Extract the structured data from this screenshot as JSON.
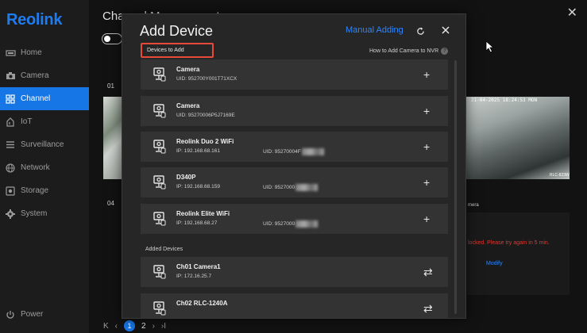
{
  "sidebar": {
    "logo": "Reolink",
    "items": [
      {
        "label": "Home",
        "icon": "home-icon"
      },
      {
        "label": "Camera",
        "icon": "camera-icon"
      },
      {
        "label": "Channel",
        "icon": "channel-grid-icon",
        "active": true
      },
      {
        "label": "IoT",
        "icon": "iot-icon"
      },
      {
        "label": "Surveillance",
        "icon": "surveillance-list-icon"
      },
      {
        "label": "Network",
        "icon": "globe-icon"
      },
      {
        "label": "Storage",
        "icon": "storage-icon"
      },
      {
        "label": "System",
        "icon": "gear-icon"
      }
    ],
    "power_label": "Power"
  },
  "background": {
    "title": "Channel Management",
    "tile_labels": [
      "01",
      "04"
    ],
    "feed_timestamp": "21-04-2025 18:24:53 MON",
    "feed_camera_id": "RLC-823W",
    "camera_label": "mera",
    "locked_message": "locked. Please try again in 5 min.",
    "modify_label": "Modify",
    "pager": {
      "current": "1",
      "next": "2"
    }
  },
  "modal": {
    "title": "Add Device",
    "manual_adding": "Manual Adding",
    "devices_to_add_label": "Devices to Add",
    "how_to_label": "How to Add Camera to NVR",
    "devices_to_add": [
      {
        "name": "Camera",
        "sub": "UID: 952700Y001T71XCX",
        "uid": "",
        "masked": false
      },
      {
        "name": "Camera",
        "sub": "UID: 95270006P5J7169E",
        "uid": "",
        "masked": false
      },
      {
        "name": "Reolink Duo 2 WiFi",
        "sub": "IP: 192.168.68.161",
        "uid": "UID: 95270004F",
        "masked": true
      },
      {
        "name": "D340P",
        "sub": "IP: 192.168.68.159",
        "uid": "UID: 9527000",
        "masked": true
      },
      {
        "name": "Reolink Elite WiFi",
        "sub": "IP: 192.168.68.27",
        "uid": "UID: 9527000",
        "masked": true
      }
    ],
    "added_devices_label": "Added Devices",
    "added_devices": [
      {
        "name": "Ch01 Camera1",
        "sub": "IP: 172.16.25.7"
      },
      {
        "name": "Ch02 RLC-1240A",
        "sub": ""
      }
    ]
  },
  "colors": {
    "accent": "#1776e6",
    "link": "#2b86ff",
    "highlight_border": "#e84a3a",
    "error": "#e0362f"
  }
}
